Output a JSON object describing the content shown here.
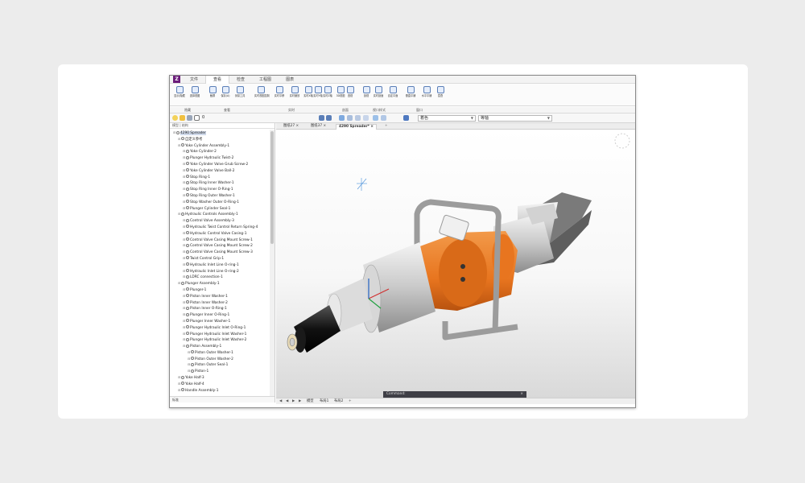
{
  "menu": {
    "tabs": [
      "文件",
      "查看",
      "检查",
      "工程图",
      "图表"
    ],
    "active_index": 1
  },
  "ribbon": {
    "tools": [
      "显示/隐藏",
      "选择视图",
      "截屏",
      "保存(A)",
      "测量工具",
      "实时视图控制",
      "实时平移",
      "实时缩放",
      "实时X轴",
      "实时Y轴",
      "实时Z轴",
      "3D视图",
      "透视",
      "剖视",
      "实时剖面",
      "自定平面",
      "垂直平铺",
      "水平平铺",
      "层叠"
    ],
    "groups": [
      "隐藏",
      "查看",
      "实时",
      "剖面",
      "视口样式",
      "窗口"
    ]
  },
  "toolbar2": {
    "layer_value": "0",
    "visual_style": "着色",
    "view_preset": "等轴"
  },
  "panel": {
    "header": "模型 | 结构",
    "footer": "标准",
    "tree": [
      {
        "label": "4290 Spreader",
        "level": 0,
        "selected": true
      },
      {
        "label": "自定义参考",
        "level": 1
      },
      {
        "label": "Yoke Cylinder Assembly-1",
        "level": 1
      },
      {
        "label": "Yoke Cylinder-2",
        "level": 2
      },
      {
        "label": "Plunger Hydraulic Twist-2",
        "level": 2
      },
      {
        "label": "Yoke Cylinder Valve Grub Screw-2",
        "level": 2
      },
      {
        "label": "Yoke Cylinder Valve Ball-2",
        "level": 2
      },
      {
        "label": "Stop Ring-1",
        "level": 2
      },
      {
        "label": "Stop Ring Inner Washer-1",
        "level": 2
      },
      {
        "label": "Stop Ring Inner O-Ring-1",
        "level": 2
      },
      {
        "label": "Stop Ring Outer Washer-1",
        "level": 2
      },
      {
        "label": "Stop Washer Outer O-Ring-1",
        "level": 2
      },
      {
        "label": "Plunger Cylinder Seal-1",
        "level": 2
      },
      {
        "label": "Hydraulic Controls Assembly-1",
        "level": 1
      },
      {
        "label": "Control Valve Assembly-3",
        "level": 2
      },
      {
        "label": "Hydraulic Twist Control Return Spring-4",
        "level": 2
      },
      {
        "label": "Hydraulic Control Valve Casing-1",
        "level": 2
      },
      {
        "label": "Control Valve Casing Mount Screw-1",
        "level": 2
      },
      {
        "label": "Control Valve Casing Mount Screw-2",
        "level": 2
      },
      {
        "label": "Control Valve Casing Mount Screw-3",
        "level": 2
      },
      {
        "label": "Twist Control Grip-1",
        "level": 2
      },
      {
        "label": "Hydraulic Inlet Line O-ring-1",
        "level": 2
      },
      {
        "label": "Hydraulic Inlet Line O-ring-2",
        "level": 2
      },
      {
        "label": "LDRC connection-1",
        "level": 2
      },
      {
        "label": "Plunger Assembly-1",
        "level": 1
      },
      {
        "label": "Plunger-1",
        "level": 2
      },
      {
        "label": "Piston Inner Washer-1",
        "level": 2
      },
      {
        "label": "Piston Inner Washer-2",
        "level": 2
      },
      {
        "label": "Piston Inner O-Ring-1",
        "level": 2
      },
      {
        "label": "Plunger Inner O-Ring-1",
        "level": 2
      },
      {
        "label": "Plunger Inner Washer-1",
        "level": 2
      },
      {
        "label": "Plunger Hydraulic Inlet O-Ring-1",
        "level": 2
      },
      {
        "label": "Plunger Hydraulic Inlet Washer-1",
        "level": 2
      },
      {
        "label": "Plunger Hydraulic Inlet Washer-2",
        "level": 2
      },
      {
        "label": "Piston Assembly-1",
        "level": 2
      },
      {
        "label": "Piston Outer Washer-1",
        "level": 3
      },
      {
        "label": "Piston Outer Washer-2",
        "level": 3
      },
      {
        "label": "Piston Outer Seal-1",
        "level": 3
      },
      {
        "label": "Piston-1",
        "level": 3
      },
      {
        "label": "Yoke Half-3",
        "level": 1
      },
      {
        "label": "Yoke Half-4",
        "level": 1
      },
      {
        "label": "Handle Assembly-1",
        "level": 1
      }
    ]
  },
  "doc_tabs": [
    {
      "label": "图纸27",
      "active": false
    },
    {
      "label": "图纸37",
      "active": false
    },
    {
      "label": "4290 Spreader*",
      "active": true
    }
  ],
  "command": {
    "label": "Command:"
  },
  "status": {
    "tab": "模型",
    "layout1": "布局1",
    "layout2": "布局2"
  },
  "colors": {
    "orange": "#e8751f",
    "purple": "#6a1b7a",
    "accent": "#5b7fb8"
  }
}
